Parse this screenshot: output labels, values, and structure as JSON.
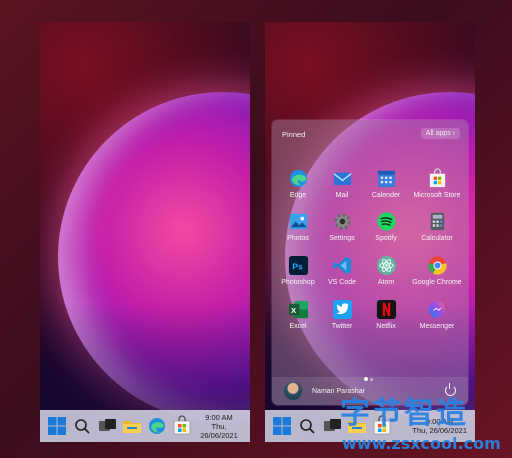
{
  "left_screen": {
    "taskbar": {
      "icons": [
        "windows-start-icon",
        "search-icon",
        "task-view-icon",
        "file-explorer-icon",
        "edge-icon",
        "microsoft-store-icon"
      ],
      "time": "9:00 AM",
      "date": "Thu, 26/06/2021"
    }
  },
  "right_screen": {
    "start_menu": {
      "pinned_label": "Pinned",
      "all_apps_label": "All apps",
      "all_apps_chevron": "›",
      "apps": [
        {
          "label": "Edge",
          "icon": "edge-icon",
          "color": "#1f8fdf"
        },
        {
          "label": "Mail",
          "icon": "mail-icon",
          "color": "#2a74d8"
        },
        {
          "label": "Calender",
          "icon": "calendar-icon",
          "color": "#3a7bd8"
        },
        {
          "label": "Microsoft Store",
          "icon": "microsoft-store-icon",
          "color": "#f2f2f2"
        },
        {
          "label": "Photos",
          "icon": "photos-icon",
          "color": "#3aa0e8"
        },
        {
          "label": "Settings",
          "icon": "settings-icon",
          "color": "#8a8a8a"
        },
        {
          "label": "Spotify",
          "icon": "spotify-icon",
          "color": "#1ed760"
        },
        {
          "label": "Calculator",
          "icon": "calculator-icon",
          "color": "#5a5a64"
        },
        {
          "label": "Photoshop",
          "icon": "photoshop-icon",
          "color": "#001e36"
        },
        {
          "label": "VS Code",
          "icon": "vscode-icon",
          "color": "#1e8ad8"
        },
        {
          "label": "Atom",
          "icon": "atom-icon",
          "color": "#66b0a0"
        },
        {
          "label": "Google Chrome",
          "icon": "chrome-icon",
          "color": "#e8453c"
        },
        {
          "label": "Excel",
          "icon": "excel-icon",
          "color": "#1d6f42"
        },
        {
          "label": "Twitter",
          "icon": "twitter-icon",
          "color": "#1da1f2"
        },
        {
          "label": "Netflix",
          "icon": "netflix-icon",
          "color": "#141414"
        },
        {
          "label": "Messenger",
          "icon": "messenger-icon",
          "color": "#a54ae8"
        }
      ],
      "user_name": "Naman Parashar"
    },
    "taskbar": {
      "time": "9:00 AM",
      "date": "Thu, 26/06/2021"
    }
  },
  "watermark": {
    "text": "字节智造",
    "url": "www.zsxcool.com"
  }
}
